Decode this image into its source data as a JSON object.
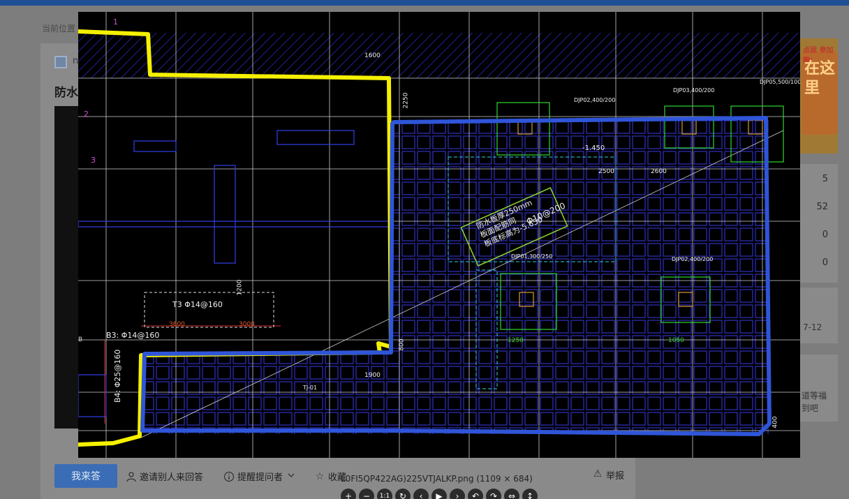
{
  "page": {
    "breadcrumb": "当前位置",
    "user_initial": "n",
    "question_title": "防水",
    "ad_text": "点我 参加啊!",
    "ad_big": "在这里",
    "stats": [
      "5",
      "52",
      "0",
      "0"
    ],
    "date_fragment": "7-12",
    "promo_lines": [
      "道等福",
      "到吧"
    ]
  },
  "actions": {
    "answer_label": "我来答",
    "invite_label": "邀请别人来回答",
    "remind_label": "提醒提问者",
    "collect_label": "收藏",
    "report_label": "举报"
  },
  "viewer": {
    "caption": "L0FI5QP422AG)225VTJALKP.png (1109 × 684)",
    "toolbar": [
      "+",
      "−",
      "1:1",
      "↻",
      "‹",
      "▶",
      "›",
      "↶",
      "↷",
      "⇔",
      "↕"
    ],
    "drawing_labels": {
      "note1": "防水板厚250mm",
      "note2": "板面配筋同",
      "note3": "板底标高为-5.650",
      "rebar_main": "Φ10@200",
      "t3": "T3  Φ14@160",
      "b3": "B3: Φ14@160",
      "b4": "B4: Φ25@160",
      "dim_3600": "3600",
      "dim_3000": "3000",
      "dim_1600": "1600",
      "dim_1200": "1200",
      "dim_1900": "1900",
      "dim_2250": "2250",
      "dim_2500": "2500",
      "dim_2600": "2600",
      "dim_1250": "1250",
      "dim_1050": "1050",
      "dim_800": "800",
      "dim_400": "400",
      "elev": "-1.450",
      "cap1": "DJP02,400/200",
      "cap2": "DJP03,400/200",
      "cap3": "DJP05,500/100",
      "cap4": "DJP01,300/250",
      "cap5": "DJP02,400/200",
      "grid1": "1",
      "grid2": "2",
      "grid3": "3",
      "grid4": "B",
      "tj": "TJ-01"
    }
  }
}
